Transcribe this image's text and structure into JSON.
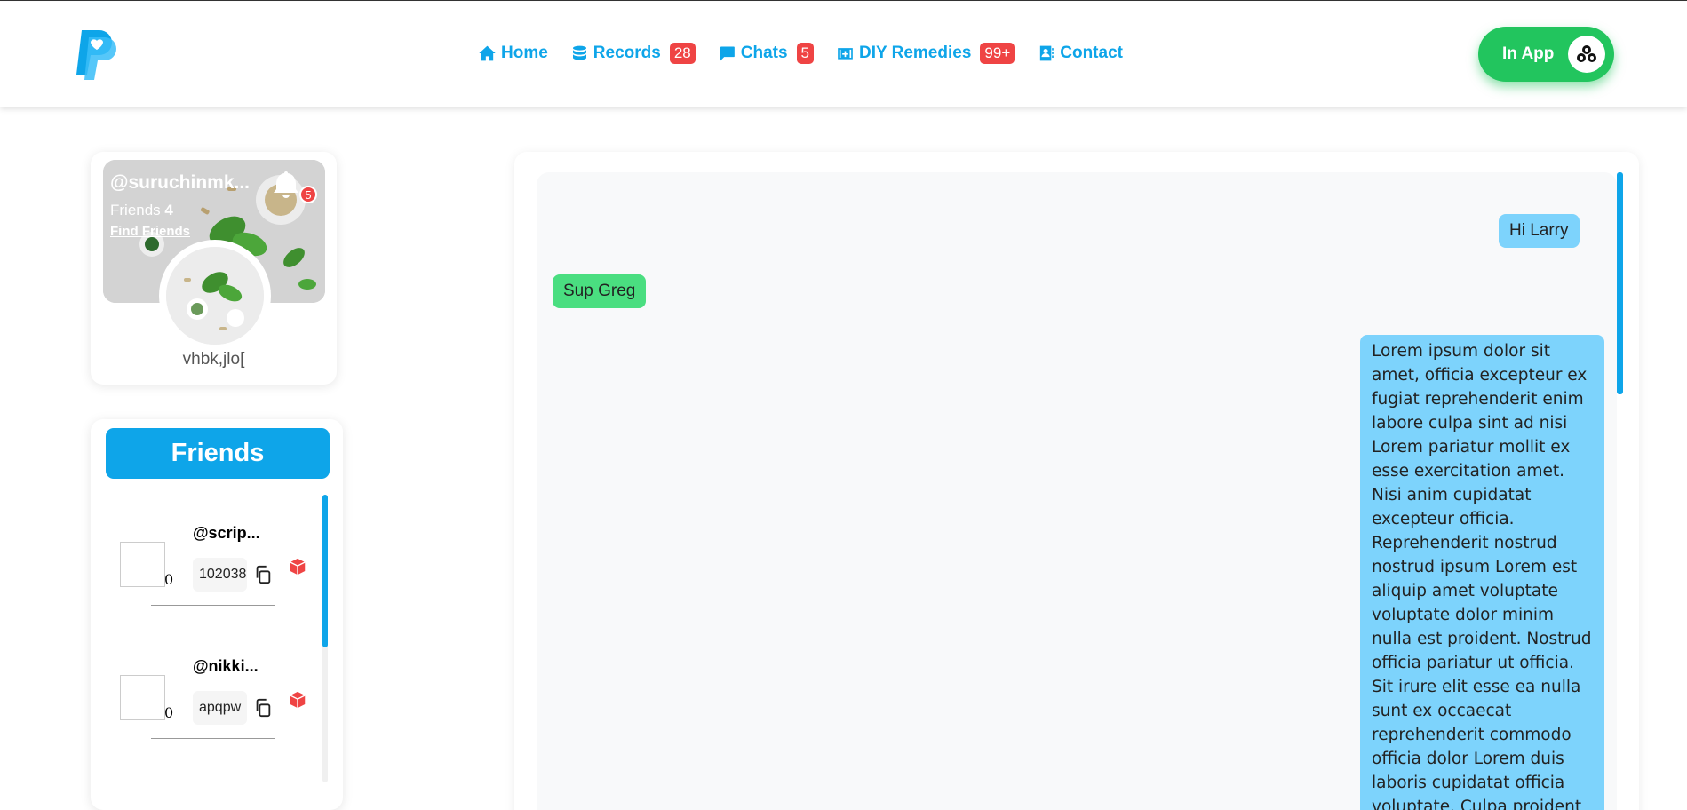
{
  "header": {
    "nav": [
      {
        "label": "Home",
        "icon": "home-icon"
      },
      {
        "label": "Records",
        "icon": "database-icon",
        "badge": "28"
      },
      {
        "label": "Chats",
        "icon": "chat-icon",
        "badge": "5"
      },
      {
        "label": "DIY Remedies",
        "icon": "medkit-icon",
        "badge": "99+"
      },
      {
        "label": "Contact",
        "icon": "contact-icon"
      }
    ],
    "in_app_label": "In App"
  },
  "profile": {
    "username": "@suruchinmk...",
    "friends_label": "Friends",
    "friends_count": "4",
    "find_friends_label": "Find Friends",
    "notification_count": "5",
    "display_name": "vhbk,jlo["
  },
  "friends_panel": {
    "title": "Friends",
    "items": [
      {
        "name": "@scrip...",
        "count": "0",
        "code": "102038"
      },
      {
        "name": "@nikki...",
        "count": "0",
        "code": "apqpw"
      }
    ]
  },
  "chat": {
    "messages": [
      {
        "side": "right",
        "text": "Hi Larry"
      },
      {
        "side": "left",
        "text": "Sup Greg"
      },
      {
        "side": "right",
        "text": "Lorem ipsum dolor sit amet, officia excepteur ex fugiat reprehenderit enim labore culpa sint ad nisi Lorem pariatur mollit ex esse exercitation amet. Nisi anim cupidatat excepteur officia. Reprehenderit nostrud nostrud ipsum Lorem est aliquip amet voluptate voluptate dolor minim nulla est proident. Nostrud officia pariatur ut officia. Sit irure elit esse ea nulla sunt ex occaecat reprehenderit commodo officia dolor Lorem duis laboris cupidatat officia voluptate. Culpa proident adipisicing id nulla nisi"
      }
    ]
  },
  "colors": {
    "accent": "#0ea5e9",
    "badge": "#ef4444",
    "in_app": "#22c55e",
    "bubble_sent": "#7dd3fc",
    "bubble_received": "#4ade80"
  }
}
